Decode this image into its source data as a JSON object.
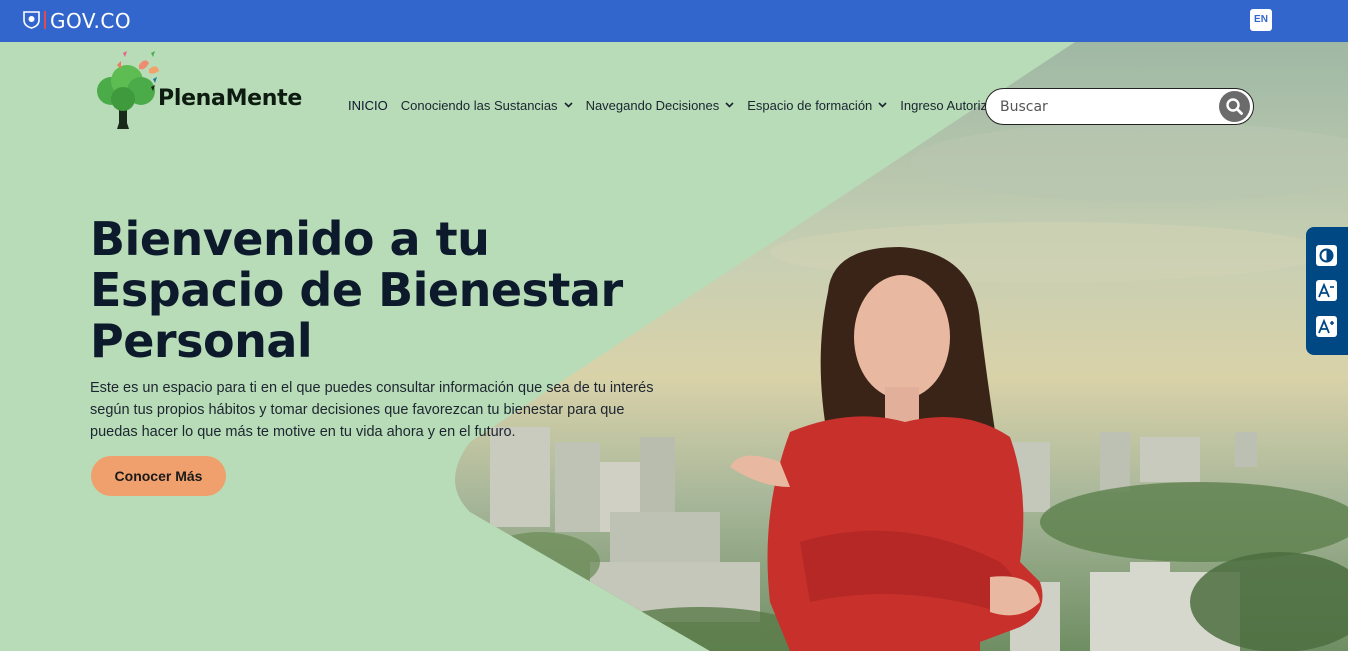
{
  "govbar": {
    "text": "GOV.CO",
    "lang_label": "EN",
    "color": "#3366cc"
  },
  "brand": {
    "name": "PlenaMente"
  },
  "nav": {
    "items": [
      {
        "label": "INICIO",
        "dropdown": false
      },
      {
        "label": "Conociendo las Sustancias",
        "dropdown": true
      },
      {
        "label": "Navegando Decisiones",
        "dropdown": true
      },
      {
        "label": "Espacio de formación",
        "dropdown": true
      },
      {
        "label": "Ingreso Autorizado",
        "dropdown": false
      }
    ]
  },
  "search": {
    "placeholder": "Buscar",
    "value": "",
    "icon": "search-icon"
  },
  "accessibility": {
    "buttons": [
      {
        "icon": "contrast-icon"
      },
      {
        "icon": "decrease-font-icon"
      },
      {
        "icon": "increase-font-icon"
      }
    ]
  },
  "hero": {
    "title_lines": [
      "Bienvenido a tu",
      "Espacio de Bienestar",
      "Personal"
    ],
    "description": "Este es un espacio para ti en el que puedes consultar información que sea de tu interés según tus propios hábitos y tomar decisiones que favorezcan tu bienestar para que puedas hacer lo que más te motive en tu vida ahora y en el futuro.",
    "cta_label": "Conocer Más"
  },
  "colors": {
    "hero_green": "#b7dcb7",
    "cta_orange": "#f0a06c",
    "a11y_blue": "#004884",
    "title_navy": "#0c1a2b"
  }
}
